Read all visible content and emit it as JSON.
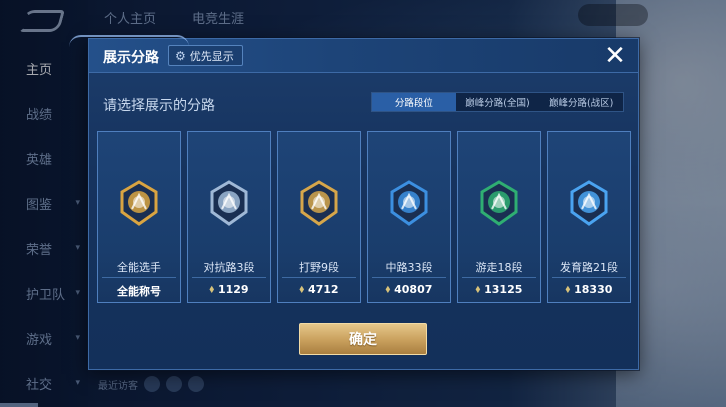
{
  "background": {
    "sidebar_items": [
      {
        "label": "主页",
        "active": true
      },
      {
        "label": "战绩"
      },
      {
        "label": "英雄"
      },
      {
        "label": "图鉴"
      },
      {
        "label": "荣誉"
      },
      {
        "label": "护卫队"
      },
      {
        "label": "游戏"
      },
      {
        "label": "社交"
      }
    ],
    "top_tabs": [
      "个人主页",
      "电竞生涯"
    ],
    "bottom_hint": "最近访客"
  },
  "dialog": {
    "title": "展示分路",
    "priority_label": "优先显示",
    "close_label": "✕",
    "prompt": "请选择展示的分路",
    "segment_tabs": [
      {
        "label": "分路段位",
        "active": true
      },
      {
        "label": "巅峰分路(全国)"
      },
      {
        "label": "巅峰分路(战区)"
      }
    ],
    "cards": [
      {
        "name": "全能选手",
        "stat": "全能称号",
        "emblem": "allround-emblem-icon",
        "color": "#d9a441"
      },
      {
        "name": "对抗路3段",
        "stat": "1129",
        "emblem": "clash-lane-emblem-icon",
        "color": "#9fb8d6"
      },
      {
        "name": "打野9段",
        "stat": "4712",
        "emblem": "jungle-emblem-icon",
        "color": "#d6a64a"
      },
      {
        "name": "中路33段",
        "stat": "40807",
        "emblem": "mid-lane-emblem-icon",
        "color": "#3c8fe0"
      },
      {
        "name": "游走18段",
        "stat": "13125",
        "emblem": "roam-emblem-icon",
        "color": "#2fae72"
      },
      {
        "name": "发育路21段",
        "stat": "18330",
        "emblem": "farm-lane-emblem-icon",
        "color": "#4aa3f0"
      }
    ],
    "confirm_label": "确定"
  }
}
